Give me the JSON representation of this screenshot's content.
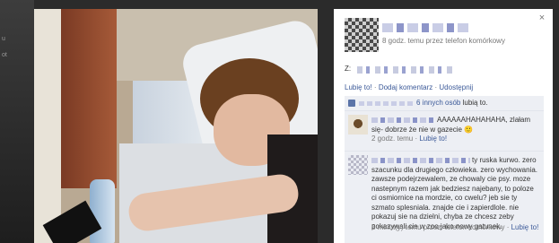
{
  "post": {
    "meta": "8 godz. temu przez telefon komórkowy",
    "tagged_prefix": "Z:",
    "actions": {
      "like": "Lubię to!",
      "separator": " · ",
      "comment": "Dodaj komentarz",
      "share": "Udostępnij"
    },
    "likes": {
      "count_link": "6 innych osób",
      "suffix": " lubią to."
    }
  },
  "comments": [
    {
      "text": "AAAAAAHAHAHAHA, zlałam się- dobrze że nie w gazecie 🙂",
      "time": "2 godz. temu",
      "separator": " · ",
      "like": "Lubię to!"
    },
    {
      "text": "ty ruska kurwo. zero szacunku dla drugiego człowieka. zero wychowania. zawsze podejrzewalem, ze chowaly cie psy. moze nastepnym razem jak bedziesz najebany, to poloze ci osmiornice na mordzie, co cwelu? jeb sie ty szmato splesniala. znajde cie i zapierdlole. nie pokazuj sie na dzielni, chyba ze chcesz zeby pokazywali cie w zoo jako nowy gatunek.",
      "time": "5 minut(y) temu przez: telefon komórkowy",
      "separator": " · ",
      "like": "Lubię to!"
    }
  ],
  "close_glyph": "×",
  "backdrop_fragments": [
    "u",
    "ot"
  ]
}
